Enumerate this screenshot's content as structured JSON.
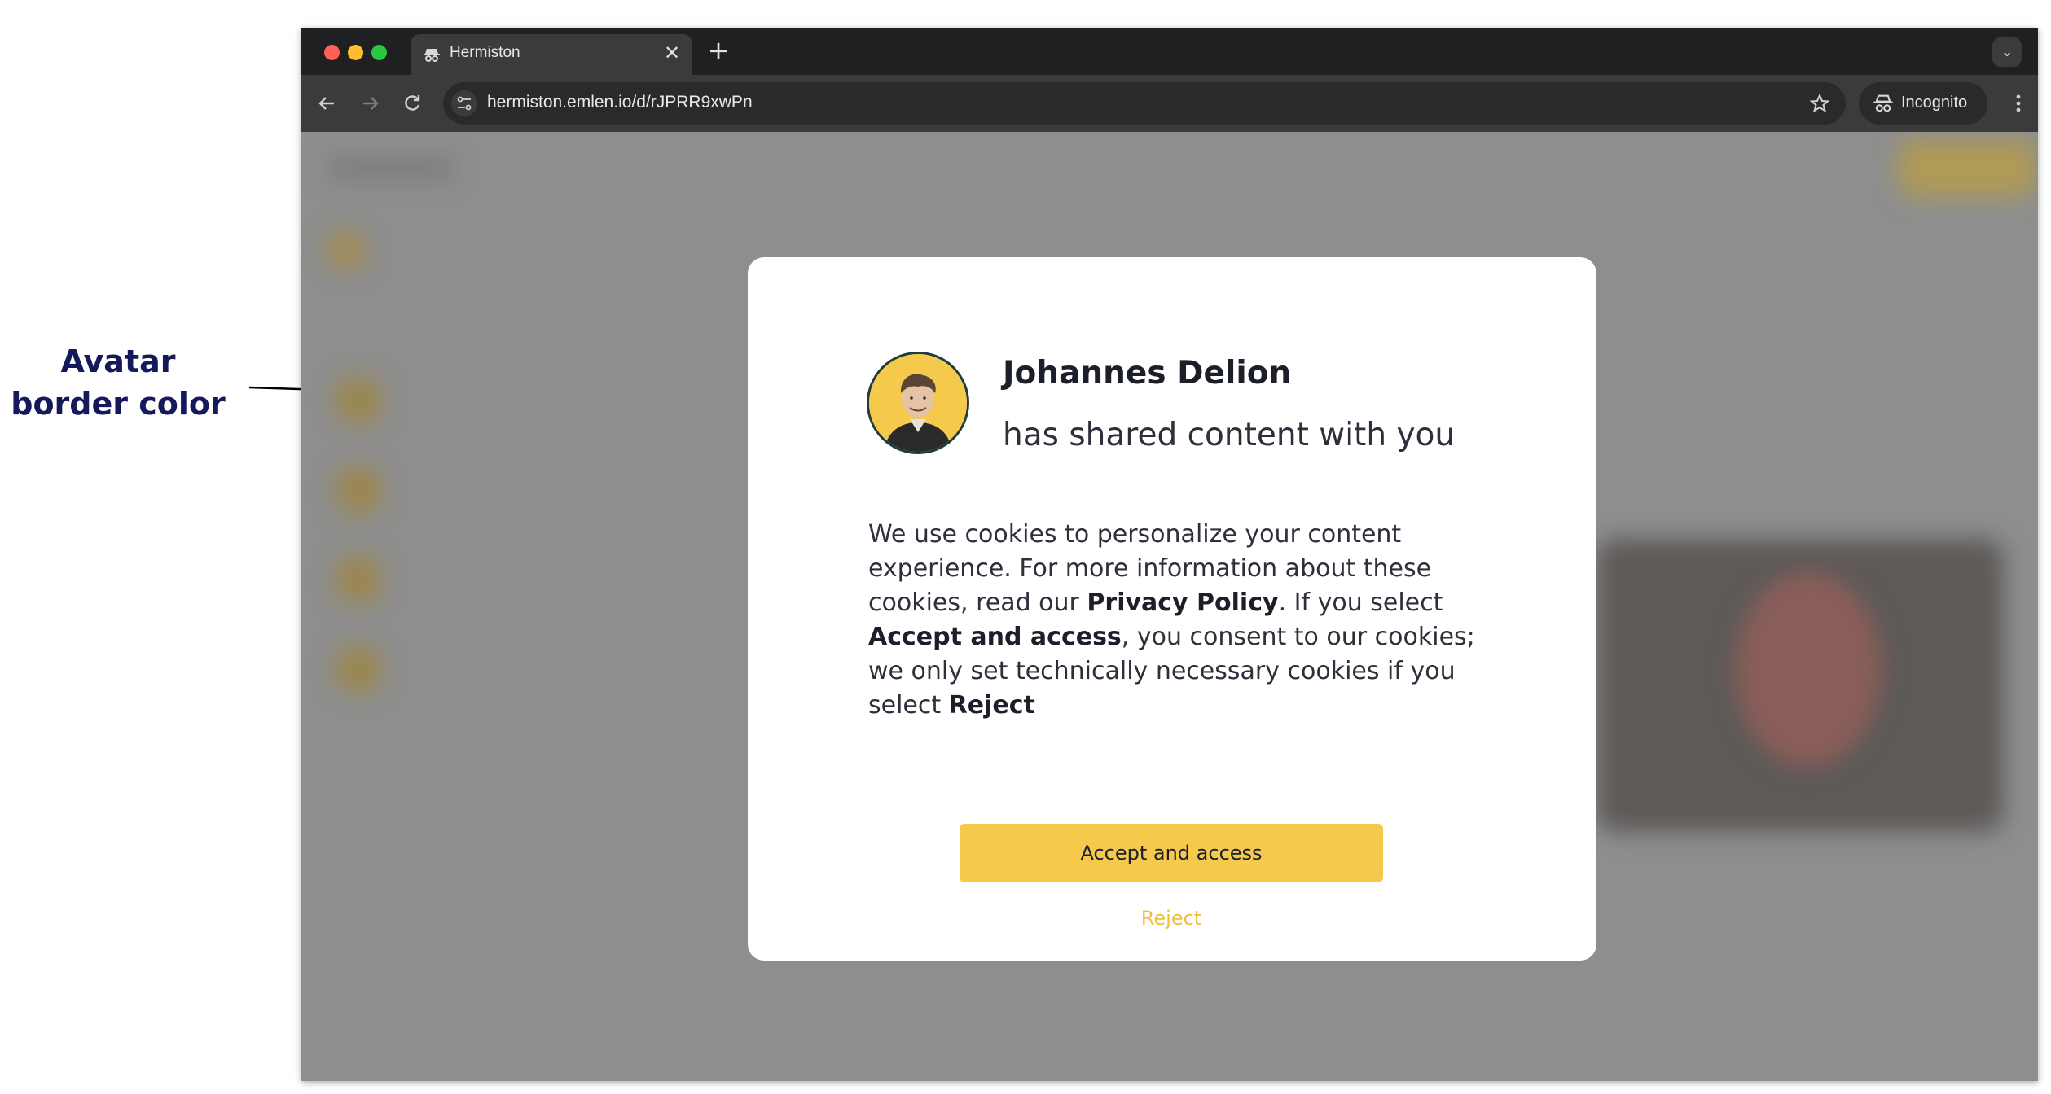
{
  "annotation": {
    "line1": "Avatar",
    "line2": "border color"
  },
  "browser": {
    "tab": {
      "title": "Hermiston",
      "close_icon": "close-icon",
      "favicon": "incognito-favicon"
    },
    "new_tab_icon": "plus-icon",
    "tab_menu_icon": "chevron-down-icon",
    "toolbar": {
      "back_icon": "arrow-left-icon",
      "forward_icon": "arrow-right-icon",
      "reload_icon": "reload-icon",
      "site_info_icon": "tune-icon",
      "url": "hermiston.emlen.io/d/rJPRR9xwPn",
      "bookmark_icon": "star-icon",
      "incognito_label": "Incognito",
      "menu_icon": "kebab-menu-icon"
    }
  },
  "modal": {
    "sharer_name": "Johannes Delion",
    "share_message": "has shared content with you",
    "cookie_notice": {
      "part1": "We use cookies to personalize your content experience. For more information about these cookies, read our ",
      "privacy_policy": "Privacy Policy",
      "part2": ". If you select ",
      "accept_ref": "Accept and access",
      "part3": ", you consent to our cookies; we only set technically necessary cookies if you select ",
      "reject_ref": "Reject"
    },
    "accept_button": "Accept and access",
    "reject_link": "Reject"
  },
  "colors": {
    "accent": "#f4c94c",
    "reject_text": "#f0bd3c",
    "avatar_border": "#1f3d3d",
    "annotation_text": "#14195a"
  }
}
